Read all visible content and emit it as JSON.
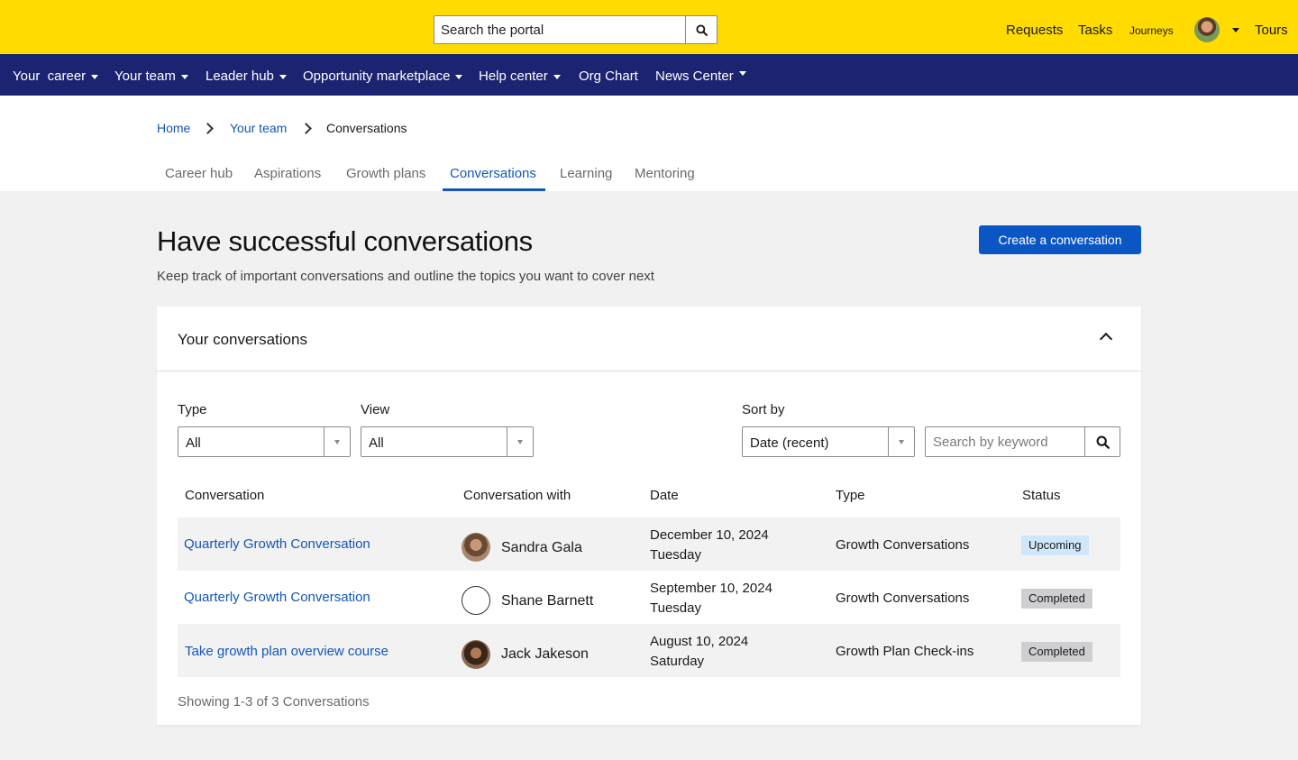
{
  "topbar": {
    "search_placeholder": "Search the portal",
    "links": {
      "requests": "Requests",
      "tasks": "Tasks",
      "journeys": "Journeys",
      "tours": "Tours"
    }
  },
  "nav": {
    "items": [
      {
        "label": "Your  career",
        "dropdown": true
      },
      {
        "label": "Your team",
        "dropdown": true
      },
      {
        "label": "Leader hub",
        "dropdown": true
      },
      {
        "label": "Opportunity marketplace",
        "dropdown": true
      },
      {
        "label": "Help center",
        "dropdown": true
      },
      {
        "label": "Org Chart",
        "dropdown": false
      },
      {
        "label": "News Center",
        "dropdown": true
      }
    ]
  },
  "breadcrumb": {
    "home": "Home",
    "team": "Your team",
    "current": "Conversations"
  },
  "tabs": [
    "Career hub",
    "Aspirations",
    "Growth plans",
    "Conversations",
    "Learning",
    "Mentoring"
  ],
  "active_tab": "Conversations",
  "page": {
    "title": "Have successful conversations",
    "subtitle": "Keep track of important conversations and outline the topics you want to cover next",
    "create_button": "Create a conversation"
  },
  "card": {
    "title": "Your conversations",
    "filters": {
      "type_label": "Type",
      "type_value": "All",
      "view_label": "View",
      "view_value": "All",
      "sort_label": "Sort by",
      "sort_value": "Date (recent)",
      "keyword_placeholder": "Search by keyword"
    },
    "columns": [
      "Conversation",
      "Conversation with",
      "Date",
      "Type",
      "Status"
    ],
    "rows": [
      {
        "conversation": "Quarterly Growth Conversation",
        "with": "Sandra Gala",
        "date": "December 10, 2024",
        "day": "Tuesday",
        "type": "Growth Conversations",
        "status": "Upcoming"
      },
      {
        "conversation": "Quarterly Growth Conversation",
        "with": "Shane Barnett",
        "date": "September 10, 2024",
        "day": "Tuesday",
        "type": "Growth Conversations",
        "status": "Completed"
      },
      {
        "conversation": "Take growth plan overview course",
        "with": "Jack Jakeson",
        "date": "August 10, 2024",
        "day": "Saturday",
        "type": "Growth Plan Check-ins",
        "status": "Completed"
      }
    ],
    "showing": "Showing 1-3 of 3 Conversations"
  },
  "colors": {
    "topbar": "#ffdb00",
    "navbar": "#1c2370",
    "accent": "#0a56c4",
    "link": "#1456b8",
    "badge_upcoming": "#cfe6fb",
    "badge_completed": "#cfcfd1"
  }
}
